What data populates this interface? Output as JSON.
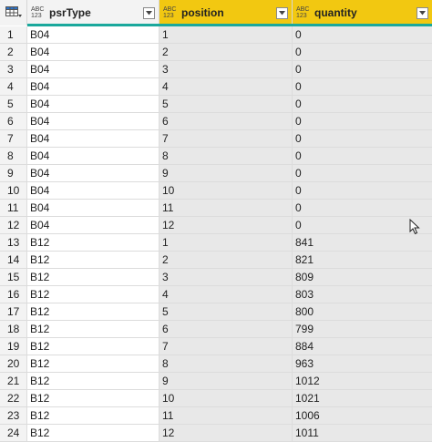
{
  "columns": {
    "psrType": {
      "type_icon_top": "ABC",
      "type_icon_bottom": "123",
      "label": "psrType"
    },
    "position": {
      "type_icon_top": "ABC",
      "type_icon_bottom": "123",
      "label": "position"
    },
    "quantity": {
      "type_icon_top": "ABC",
      "type_icon_bottom": "123",
      "label": "quantity"
    }
  },
  "colors": {
    "selected_header": "#f2c811",
    "accent_bar": "#1aa89c"
  },
  "rows": [
    {
      "idx": "1",
      "psrType": "B04",
      "position": "1",
      "quantity": "0"
    },
    {
      "idx": "2",
      "psrType": "B04",
      "position": "2",
      "quantity": "0"
    },
    {
      "idx": "3",
      "psrType": "B04",
      "position": "3",
      "quantity": "0"
    },
    {
      "idx": "4",
      "psrType": "B04",
      "position": "4",
      "quantity": "0"
    },
    {
      "idx": "5",
      "psrType": "B04",
      "position": "5",
      "quantity": "0"
    },
    {
      "idx": "6",
      "psrType": "B04",
      "position": "6",
      "quantity": "0"
    },
    {
      "idx": "7",
      "psrType": "B04",
      "position": "7",
      "quantity": "0"
    },
    {
      "idx": "8",
      "psrType": "B04",
      "position": "8",
      "quantity": "0"
    },
    {
      "idx": "9",
      "psrType": "B04",
      "position": "9",
      "quantity": "0"
    },
    {
      "idx": "10",
      "psrType": "B04",
      "position": "10",
      "quantity": "0"
    },
    {
      "idx": "11",
      "psrType": "B04",
      "position": "11",
      "quantity": "0"
    },
    {
      "idx": "12",
      "psrType": "B04",
      "position": "12",
      "quantity": "0"
    },
    {
      "idx": "13",
      "psrType": "B12",
      "position": "1",
      "quantity": "841"
    },
    {
      "idx": "14",
      "psrType": "B12",
      "position": "2",
      "quantity": "821"
    },
    {
      "idx": "15",
      "psrType": "B12",
      "position": "3",
      "quantity": "809"
    },
    {
      "idx": "16",
      "psrType": "B12",
      "position": "4",
      "quantity": "803"
    },
    {
      "idx": "17",
      "psrType": "B12",
      "position": "5",
      "quantity": "800"
    },
    {
      "idx": "18",
      "psrType": "B12",
      "position": "6",
      "quantity": "799"
    },
    {
      "idx": "19",
      "psrType": "B12",
      "position": "7",
      "quantity": "884"
    },
    {
      "idx": "20",
      "psrType": "B12",
      "position": "8",
      "quantity": "963"
    },
    {
      "idx": "21",
      "psrType": "B12",
      "position": "9",
      "quantity": "1012"
    },
    {
      "idx": "22",
      "psrType": "B12",
      "position": "10",
      "quantity": "1021"
    },
    {
      "idx": "23",
      "psrType": "B12",
      "position": "11",
      "quantity": "1006"
    },
    {
      "idx": "24",
      "psrType": "B12",
      "position": "12",
      "quantity": "1011"
    }
  ]
}
